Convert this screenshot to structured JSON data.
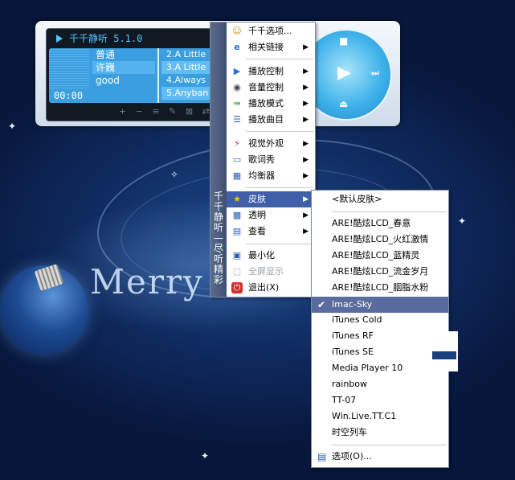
{
  "player": {
    "title": "千千静听 5.1.0",
    "time": "00:00",
    "info": [
      "普通",
      "许巍",
      "good"
    ],
    "playlist": [
      "2.A Little",
      "3.A Little",
      "4.Always",
      "5.Anyban"
    ],
    "tool_icons": "+ − ≡ ✎ ⊠ ⇄ ⚙"
  },
  "desktop": {
    "greeting": "Merry C"
  },
  "main_menu": {
    "side_title": "千千静听—尽听精彩",
    "items": [
      {
        "label": "千千选项...",
        "icon": "options-icon",
        "glyph": "☺",
        "submenu": false
      },
      {
        "label": "相关链接",
        "icon": "link-icon",
        "glyph": "e",
        "submenu": true
      },
      {
        "label": "播放控制",
        "icon": "play-control-icon",
        "glyph": "▶",
        "submenu": true
      },
      {
        "label": "音量控制",
        "icon": "volume-icon",
        "glyph": "◉",
        "submenu": true
      },
      {
        "label": "播放模式",
        "icon": "play-mode-icon",
        "glyph": "⇛",
        "submenu": true
      },
      {
        "label": "播放曲目",
        "icon": "playlist-icon",
        "glyph": "☰",
        "submenu": true
      },
      {
        "label": "视觉外观",
        "icon": "visual-icon",
        "glyph": "⚡",
        "submenu": true
      },
      {
        "label": "歌词秀",
        "icon": "lyrics-icon",
        "glyph": "▭",
        "submenu": true
      },
      {
        "label": "均衡器",
        "icon": "equalizer-icon",
        "glyph": "▦",
        "submenu": true
      },
      {
        "label": "皮肤",
        "icon": "skin-star-icon",
        "glyph": "★",
        "submenu": true
      },
      {
        "label": "透明",
        "icon": "transparency-icon",
        "glyph": "▩",
        "submenu": true
      },
      {
        "label": "查看",
        "icon": "view-icon",
        "glyph": "▤",
        "submenu": true
      },
      {
        "label": "最小化",
        "icon": "minimize-icon",
        "glyph": "▣",
        "submenu": false
      },
      {
        "label": "全屏显示",
        "icon": "fullscreen-icon",
        "glyph": "▢",
        "submenu": false
      },
      {
        "label": "退出(X)",
        "icon": "exit-icon",
        "glyph": "⏻",
        "submenu": false
      }
    ]
  },
  "skin_menu": {
    "items": [
      "<默认皮肤>",
      "ARE!酷炫LCD_春意",
      "ARE!酷炫LCD_火红激情",
      "ARE!酷炫LCD_蓝精灵",
      "ARE!酷炫LCD_流金岁月",
      "ARE!酷炫LCD_胭脂水粉",
      "Imac-Sky",
      "iTunes Cold",
      "iTunes RF",
      "iTunes SE",
      "Media Player 10",
      "rainbow",
      "TT-07",
      "Win.Live.TT.C1",
      "时空列车",
      "选项(O)..."
    ],
    "check_mark": "✔"
  },
  "colors": {
    "menu_highlight": "#3f5fa8",
    "skin_highlight": "#5a6b9e",
    "player_lcd": "#3a9fe0"
  }
}
